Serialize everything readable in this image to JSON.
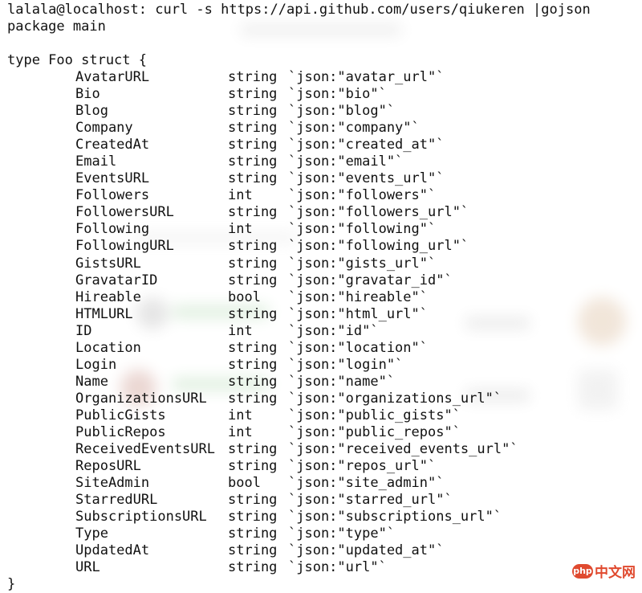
{
  "terminal": {
    "prompt_line": "lalala@localhost: curl -s https://api.github.com/users/qiukeren |gojson",
    "package_line": "package main",
    "type_line": "type Foo struct {",
    "closing_line": "}",
    "fields": [
      {
        "name": "AvatarURL",
        "type": "string",
        "tag": "`json:\"avatar_url\"`"
      },
      {
        "name": "Bio",
        "type": "string",
        "tag": "`json:\"bio\"`"
      },
      {
        "name": "Blog",
        "type": "string",
        "tag": "`json:\"blog\"`"
      },
      {
        "name": "Company",
        "type": "string",
        "tag": "`json:\"company\"`"
      },
      {
        "name": "CreatedAt",
        "type": "string",
        "tag": "`json:\"created_at\"`"
      },
      {
        "name": "Email",
        "type": "string",
        "tag": "`json:\"email\"`"
      },
      {
        "name": "EventsURL",
        "type": "string",
        "tag": "`json:\"events_url\"`"
      },
      {
        "name": "Followers",
        "type": "int",
        "tag": "`json:\"followers\"`"
      },
      {
        "name": "FollowersURL",
        "type": "string",
        "tag": "`json:\"followers_url\"`"
      },
      {
        "name": "Following",
        "type": "int",
        "tag": "`json:\"following\"`"
      },
      {
        "name": "FollowingURL",
        "type": "string",
        "tag": "`json:\"following_url\"`"
      },
      {
        "name": "GistsURL",
        "type": "string",
        "tag": "`json:\"gists_url\"`"
      },
      {
        "name": "GravatarID",
        "type": "string",
        "tag": "`json:\"gravatar_id\"`"
      },
      {
        "name": "Hireable",
        "type": "bool",
        "tag": "`json:\"hireable\"`"
      },
      {
        "name": "HTMLURL",
        "type": "string",
        "tag": "`json:\"html_url\"`"
      },
      {
        "name": "ID",
        "type": "int",
        "tag": "`json:\"id\"`"
      },
      {
        "name": "Location",
        "type": "string",
        "tag": "`json:\"location\"`"
      },
      {
        "name": "Login",
        "type": "string",
        "tag": "`json:\"login\"`"
      },
      {
        "name": "Name",
        "type": "string",
        "tag": "`json:\"name\"`"
      },
      {
        "name": "OrganizationsURL",
        "type": "string",
        "tag": "`json:\"organizations_url\"`"
      },
      {
        "name": "PublicGists",
        "type": "int",
        "tag": "`json:\"public_gists\"`"
      },
      {
        "name": "PublicRepos",
        "type": "int",
        "tag": "`json:\"public_repos\"`"
      },
      {
        "name": "ReceivedEventsURL",
        "type": "string",
        "tag": "`json:\"received_events_url\"`"
      },
      {
        "name": "ReposURL",
        "type": "string",
        "tag": "`json:\"repos_url\"`"
      },
      {
        "name": "SiteAdmin",
        "type": "bool",
        "tag": "`json:\"site_admin\"`"
      },
      {
        "name": "StarredURL",
        "type": "string",
        "tag": "`json:\"starred_url\"`"
      },
      {
        "name": "SubscriptionsURL",
        "type": "string",
        "tag": "`json:\"subscriptions_url\"`"
      },
      {
        "name": "Type",
        "type": "string",
        "tag": "`json:\"type\"`"
      },
      {
        "name": "UpdatedAt",
        "type": "string",
        "tag": "`json:\"updated_at\"`"
      },
      {
        "name": "URL",
        "type": "string",
        "tag": "`json:\"url\"`"
      }
    ]
  },
  "watermark": {
    "logo_text": "php",
    "site_text": "中文网"
  },
  "colors": {
    "text": "#111111",
    "watermark": "#e04a2f"
  }
}
